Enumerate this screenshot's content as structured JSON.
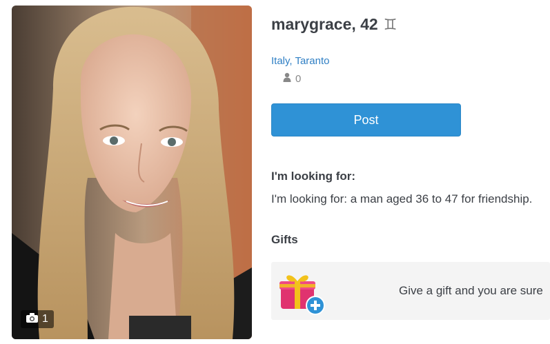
{
  "profile": {
    "name_age": "marygrace, 42",
    "zodiac_symbol": "♊",
    "zodiac_icon": "gemini-icon",
    "location": "Italy, Taranto",
    "friends_count": "0",
    "photo_count": "1"
  },
  "actions": {
    "post_label": "Post"
  },
  "looking_for": {
    "heading": "I'm looking for:",
    "text": "I'm looking for: a man aged 36 to 47 for friendship."
  },
  "gifts": {
    "heading": "Gifts",
    "prompt": "Give a gift and you are sure"
  },
  "colors": {
    "accent": "#2f92d6",
    "link": "#2f7fc4",
    "text": "#3b3f45"
  }
}
